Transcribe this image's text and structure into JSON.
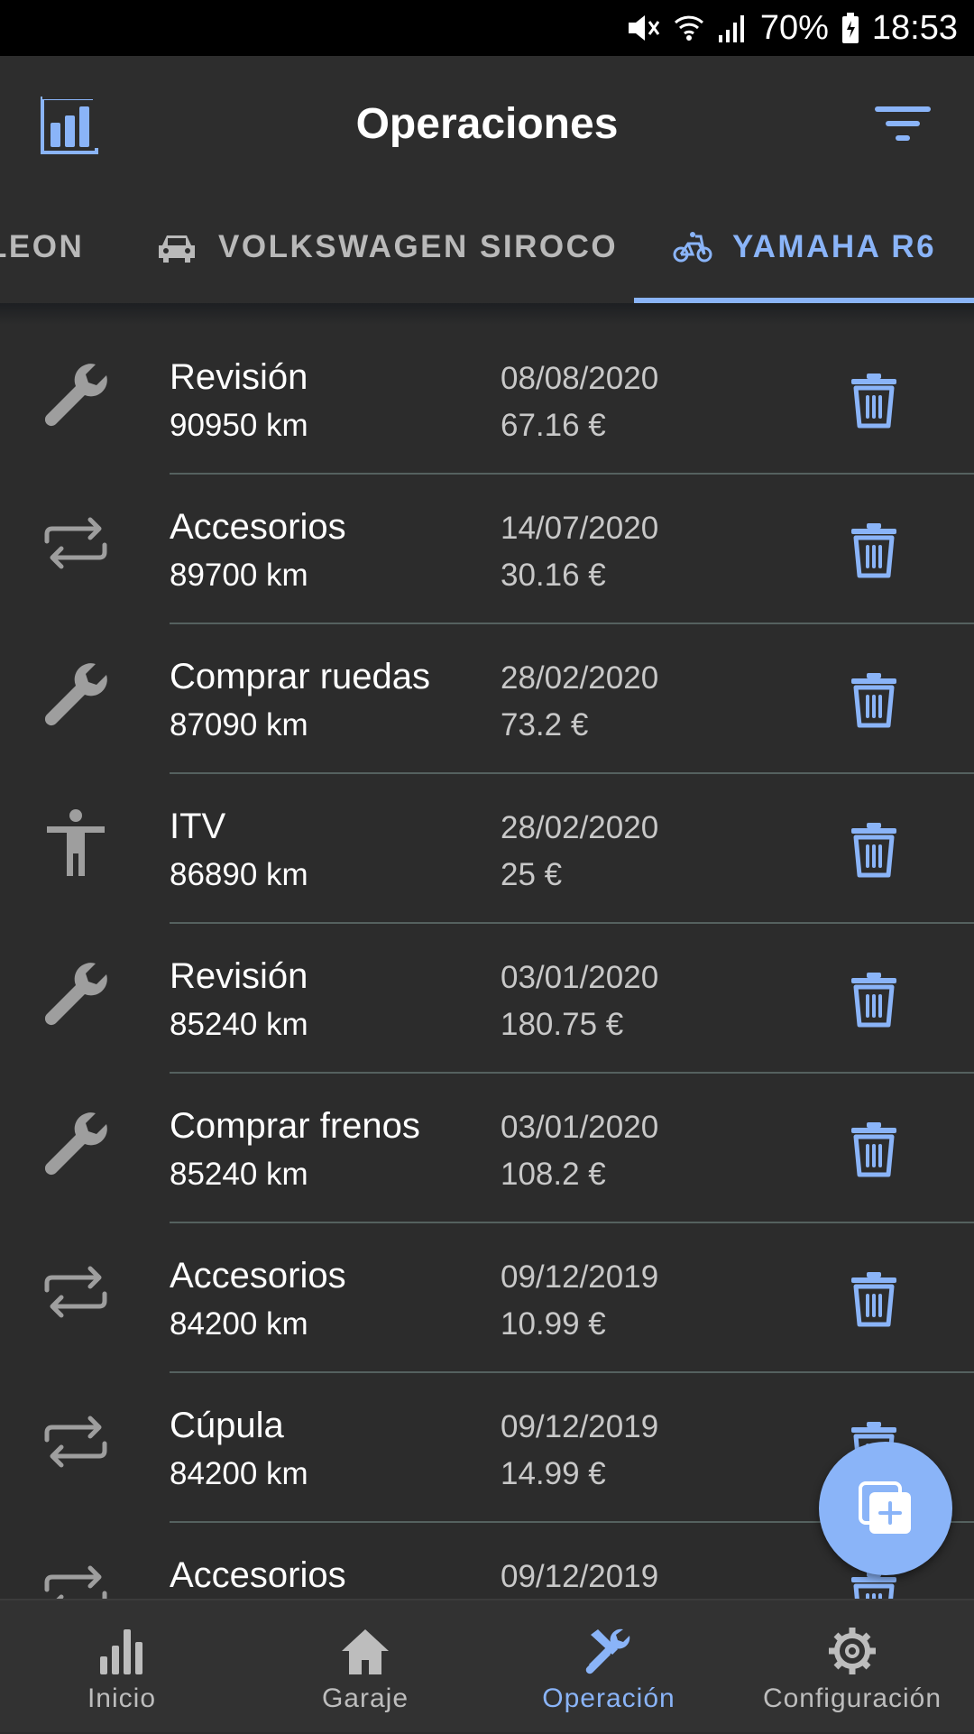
{
  "status_bar": {
    "battery": "70%",
    "time": "18:53"
  },
  "app_bar": {
    "title": "Operaciones"
  },
  "tabs": [
    {
      "label": "LEON",
      "icon": "car-icon",
      "active": false
    },
    {
      "label": "VOLKSWAGEN SIROCO",
      "icon": "car-icon",
      "active": false
    },
    {
      "label": "YAMAHA R6",
      "icon": "bicycle-icon",
      "active": true
    }
  ],
  "operations": [
    {
      "icon": "wrench-icon",
      "name": "Revisión",
      "km": "90950 km",
      "date": "08/08/2020",
      "cost": "67.16 €"
    },
    {
      "icon": "swap-icon",
      "name": "Accesorios",
      "km": "89700 km",
      "date": "14/07/2020",
      "cost": "30.16 €"
    },
    {
      "icon": "wrench-icon",
      "name": "Comprar ruedas",
      "km": "87090 km",
      "date": "28/02/2020",
      "cost": "73.2 €"
    },
    {
      "icon": "person-icon",
      "name": "ITV",
      "km": "86890 km",
      "date": "28/02/2020",
      "cost": "25 €"
    },
    {
      "icon": "wrench-icon",
      "name": "Revisión",
      "km": "85240 km",
      "date": "03/01/2020",
      "cost": "180.75 €"
    },
    {
      "icon": "wrench-icon",
      "name": "Comprar frenos",
      "km": "85240 km",
      "date": "03/01/2020",
      "cost": "108.2 €"
    },
    {
      "icon": "swap-icon",
      "name": "Accesorios",
      "km": "84200 km",
      "date": "09/12/2019",
      "cost": "10.99 €"
    },
    {
      "icon": "swap-icon",
      "name": "Cúpula",
      "km": "84200 km",
      "date": "09/12/2019",
      "cost": "14.99 €"
    },
    {
      "icon": "swap-icon",
      "name": "Accesorios",
      "km": "",
      "date": "09/12/2019",
      "cost": ""
    }
  ],
  "bottom_nav": [
    {
      "label": "Inicio",
      "icon": "bar-chart-icon",
      "active": false
    },
    {
      "label": "Garaje",
      "icon": "home-icon",
      "active": false
    },
    {
      "label": "Operación",
      "icon": "tools-icon",
      "active": true
    },
    {
      "label": "Configuración",
      "icon": "gear-icon",
      "active": false
    }
  ],
  "colors": {
    "accent": "#8ab4f8",
    "background": "#2c2c2c",
    "status_bar": "#000000",
    "divider": "#55615f",
    "icon_gray": "#9e9e9e"
  }
}
